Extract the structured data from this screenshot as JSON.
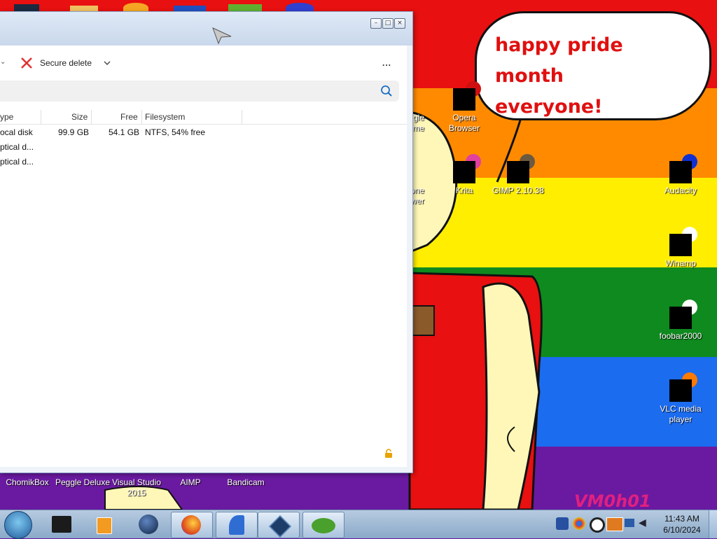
{
  "desktop": {
    "speech_bubble": {
      "line1": "happy pride month",
      "line2": "everyone!"
    },
    "watermark": "VM0h01",
    "icons_middle": [
      {
        "label_line1": "gle",
        "label_line2": "me"
      },
      {
        "label_line1": "Opera",
        "label_line2": "Browser"
      },
      {
        "label_line1": "one",
        "label_line2": "iewer"
      },
      {
        "label_line1": "Krita",
        "label_line2": ""
      },
      {
        "label_line1": "GIMP 2.10.38",
        "label_line2": ""
      }
    ],
    "icons_right": [
      {
        "label_line1": "Audacity",
        "label_line2": ""
      },
      {
        "label_line1": "Winamp",
        "label_line2": ""
      },
      {
        "label_line1": "foobar2000",
        "label_line2": ""
      },
      {
        "label_line1": "VLC media",
        "label_line2": "player"
      }
    ],
    "icons_bottom": [
      {
        "label_line1": "ChomikBox",
        "label_line2": ""
      },
      {
        "label_line1": "Peggle Deluxe",
        "label_line2": ""
      },
      {
        "label_line1": "Visual Studio",
        "label_line2": "2015"
      },
      {
        "label_line1": "AIMP",
        "label_line2": ""
      },
      {
        "label_line1": "Bandicam",
        "label_line2": ""
      }
    ],
    "colors": {
      "red": "#e81010",
      "orange": "#ff8a00",
      "yellow": "#ffee00",
      "green": "#0f8a1e",
      "blue": "#1c6cf0",
      "purple": "#6a1aa0"
    }
  },
  "window": {
    "toolbar": {
      "secure_delete_label": "Secure delete",
      "more_label": "...",
      "secure_delete_icon": "red-x-icon"
    },
    "search": {
      "icon": "search-icon"
    },
    "columns": {
      "type": "ype",
      "size": "Size",
      "free": "Free",
      "filesystem": "Filesystem"
    },
    "rows": [
      {
        "type": "ocal disk",
        "size": "99.9 GB",
        "free": "54.1 GB",
        "filesystem": "NTFS, 54% free"
      },
      {
        "type": "ptical d...",
        "size": "",
        "free": "",
        "filesystem": ""
      },
      {
        "type": "ptical d...",
        "size": "",
        "free": "",
        "filesystem": ""
      }
    ],
    "status_icon": "lock-icon"
  },
  "taskbar": {
    "time": "11:43 AM",
    "date": "6/10/2024",
    "buttons": [
      "start-orb",
      "chomikbox",
      "media-player",
      "globe",
      "firefox",
      "peggle-shark",
      "virtualbox",
      "peggle"
    ]
  }
}
